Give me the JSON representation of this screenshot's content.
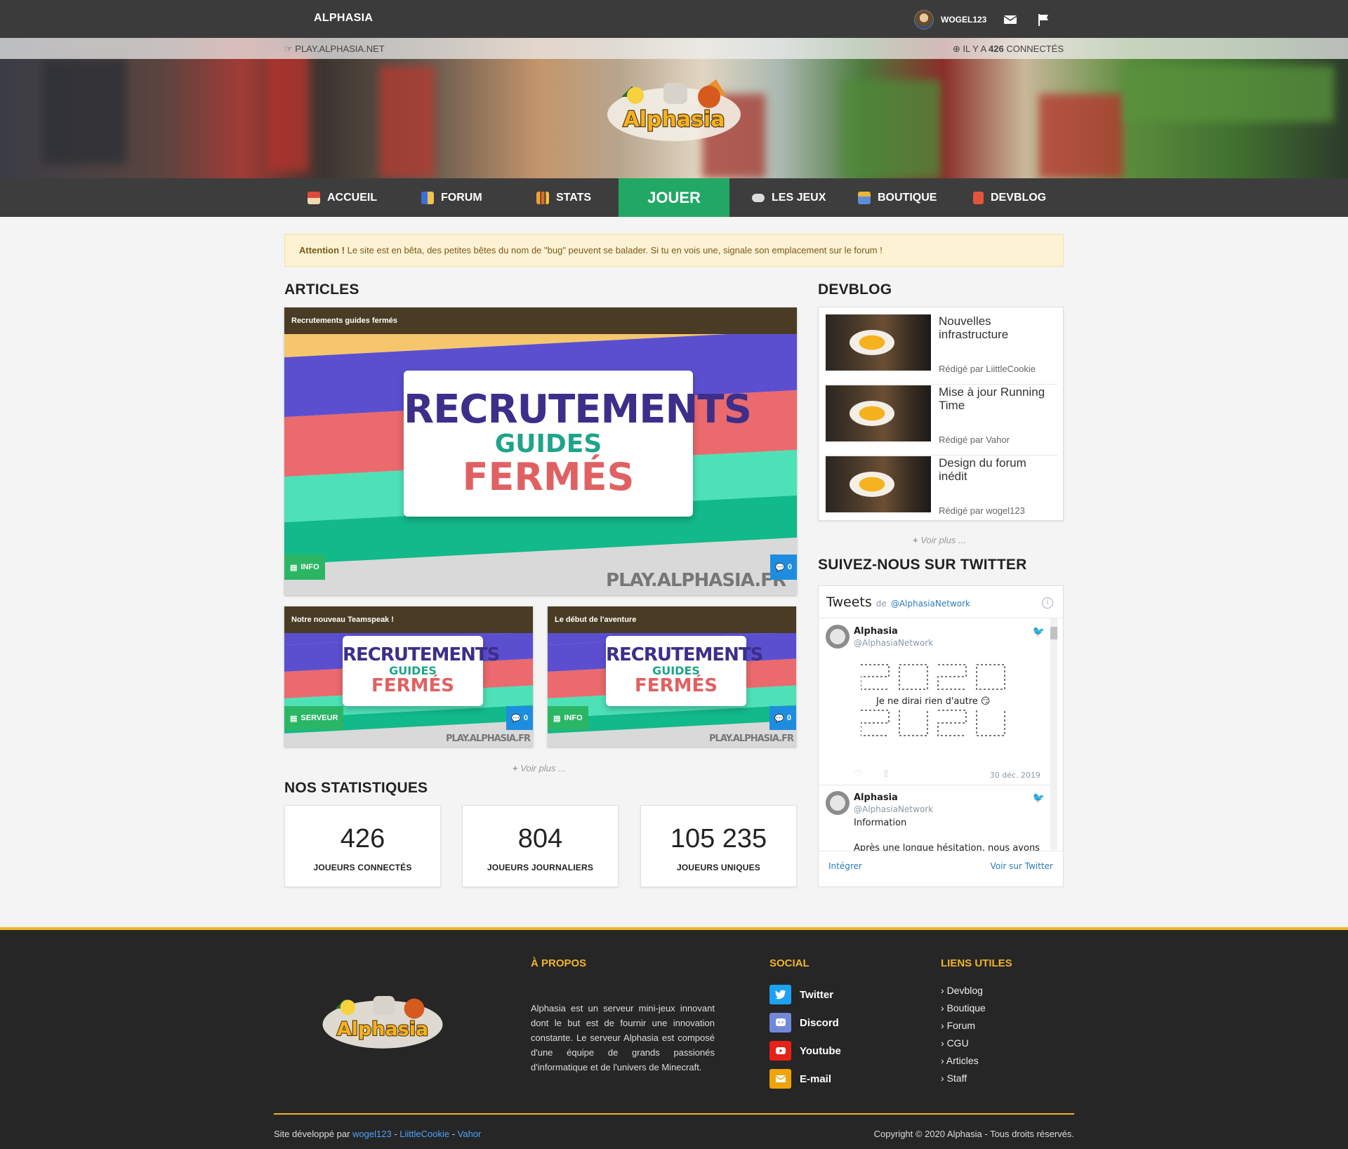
{
  "topbar": {
    "brand": "ALPHASIA",
    "username": "WOGEL123",
    "icons": [
      "mail-icon",
      "flag-icon"
    ]
  },
  "infostrip": {
    "server_ip": "PLAY.ALPHASIA.NET",
    "online_prefix": "IL Y A",
    "online_count": "426",
    "online_suffix": "CONNECTÉS"
  },
  "nav": {
    "items": [
      {
        "label": "ACCUEIL",
        "icon": "home-icon"
      },
      {
        "label": "FORUM",
        "icon": "forum-icon"
      },
      {
        "label": "STATS",
        "icon": "chart-icon"
      },
      {
        "label": "JOUER",
        "icon": ""
      },
      {
        "label": "LES JEUX",
        "icon": "gamepad-icon"
      },
      {
        "label": "BOUTIQUE",
        "icon": "shop-icon"
      },
      {
        "label": "DEVBLOG",
        "icon": "book-icon"
      }
    ]
  },
  "alert": {
    "strong": "Attention !",
    "text": "Le site est en bêta, des petites bêtes du nom de \"bug\" peuvent se balader. Si tu en vois une, signale son emplacement sur le forum !"
  },
  "articles": {
    "title": "ARTICLES",
    "featured": {
      "title": "Recrutements guides fermés",
      "tag": "INFO",
      "comments": "0",
      "img_line1": "RECRUTEMENTS",
      "img_line2": "GUIDES",
      "img_line3": "FERMÉS",
      "watermark": "PLAY.ALPHASIA.FR"
    },
    "small": [
      {
        "title": "Notre nouveau Teamspeak !",
        "tag": "SERVEUR",
        "comments": "0",
        "img_line1": "RECRUTEMENTS",
        "img_line2": "GUIDES",
        "img_line3": "FERMÉS",
        "watermark": "PLAY.ALPHASIA.FR"
      },
      {
        "title": "Le début de l'aventure",
        "tag": "INFO",
        "comments": "0",
        "img_line1": "RECRUTEMENTS",
        "img_line2": "GUIDES",
        "img_line3": "FERMÉS",
        "watermark": "PLAY.ALPHASIA.FR"
      }
    ],
    "see_more": "Voir plus ..."
  },
  "stats": {
    "title": "NOS STATISTIQUES",
    "items": [
      {
        "value": "426",
        "label": "JOUEURS CONNECTÉS"
      },
      {
        "value": "804",
        "label": "JOUEURS JOURNALIERS"
      },
      {
        "value": "105 235",
        "label": "JOUEURS UNIQUES"
      }
    ]
  },
  "devblog": {
    "title": "DEVBLOG",
    "items": [
      {
        "title": "Nouvelles infrastructure",
        "author": "Rédigé par LiittleCookie"
      },
      {
        "title": "Mise à jour Running Time",
        "author": "Rédigé par Vahor"
      },
      {
        "title": "Design du forum inédit",
        "author": "Rédigé par wogel123"
      }
    ],
    "see_more": "Voir plus ..."
  },
  "twitter": {
    "title": "SUIVEZ-NOUS SUR TWITTER",
    "widget_title": "Tweets",
    "widget_by": "de",
    "widget_handle": "@AlphasiaNetwork",
    "tweets": [
      {
        "name": "Alphasia",
        "handle": "@AlphasiaNetwork",
        "text": "Je ne dirai rien d'autre 😏",
        "date": "30 déc. 2019"
      },
      {
        "name": "Alphasia",
        "handle": "@AlphasiaNetwork",
        "text": "Information",
        "extra": "Après une longue hésitation, nous avons"
      }
    ],
    "embed": "Intégrer",
    "view": "Voir sur Twitter"
  },
  "footer": {
    "about_title": "À PROPOS",
    "about_text": "Alphasia est un serveur mini-jeux innovant dont le but est de fournir une innovation constante. Le serveur Alphasia est composé d'une équipe de grands passionés d'informatique et de l'univers de Minecraft.",
    "social_title": "SOCIAL",
    "social": [
      {
        "label": "Twitter",
        "icon": "twitter-icon",
        "color": "#1da1f2"
      },
      {
        "label": "Discord",
        "icon": "discord-icon",
        "color": "#7289da"
      },
      {
        "label": "Youtube",
        "icon": "youtube-icon",
        "color": "#e62117"
      },
      {
        "label": "E-mail",
        "icon": "mail-icon",
        "color": "#f0a30a"
      }
    ],
    "links_title": "LIENS UTILES",
    "links": [
      "Devblog",
      "Boutique",
      "Forum",
      "CGU",
      "Articles",
      "Staff"
    ],
    "credits_prefix": "Site développé par",
    "credits": [
      "wogel123",
      "LiittleCookie",
      "Vahor"
    ],
    "copyright": "Copyright © 2020 Alphasia - Tous droits réservés."
  },
  "colors": {
    "accent_green": "#21a865",
    "footer_accent": "#f0b429",
    "header": "#3b3b3b",
    "card_head": "#4a3c24"
  }
}
